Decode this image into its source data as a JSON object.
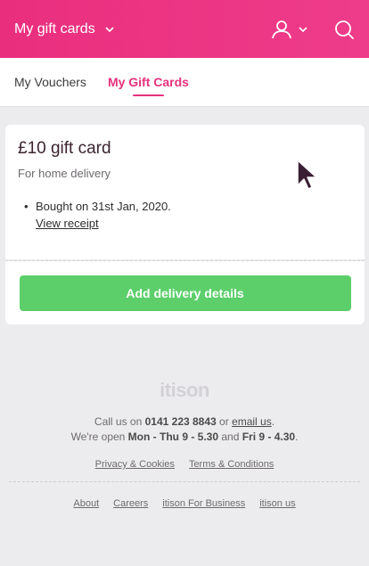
{
  "header": {
    "title": "My gift cards",
    "icons": [
      "chevron-down-icon",
      "user-icon",
      "search-icon"
    ]
  },
  "tabs": [
    {
      "label": "My Vouchers",
      "active": false
    },
    {
      "label": "My Gift Cards",
      "active": true
    }
  ],
  "card": {
    "title": "£10 gift card",
    "subtitle": "For home delivery",
    "bullet": "•",
    "purchase": "Bought on 31st Jan, 2020.",
    "receipt_link": "View receipt",
    "action_button": "Add delivery details"
  },
  "footer": {
    "logo": "itison",
    "call_prefix": "Call us on ",
    "phone": "0141 223 8843",
    "or": " or ",
    "email": "email us",
    "period": ".",
    "open_prefix": "We're open ",
    "hours_weekday": "Mon - Thu 9 - 5.30",
    "and": " and ",
    "hours_friday": "Fri 9 - 4.30",
    "period2": ".",
    "legal": [
      "Privacy & Cookies",
      "Terms & Conditions"
    ],
    "links": [
      "About",
      "Careers",
      "itison For Business",
      "itison us"
    ]
  },
  "colors": {
    "brand_pink": "#e6317d",
    "button_green": "#5ccf6b",
    "background": "#ececee"
  }
}
